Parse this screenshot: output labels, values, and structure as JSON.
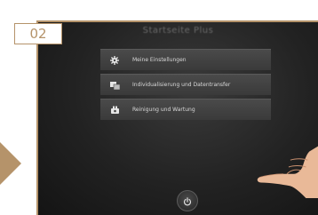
{
  "badge": {
    "number": "02"
  },
  "screen": {
    "title": "Startseite Plus",
    "menu": [
      {
        "label": "Meine Einstellungen",
        "icon": "gear-icon"
      },
      {
        "label": "Individualisierung und Datentransfer",
        "icon": "transfer-icon"
      },
      {
        "label": "Reinigung und Wartung",
        "icon": "cleaning-icon"
      }
    ],
    "power_icon": "power-icon"
  },
  "colors": {
    "accent": "#b5936a",
    "screen_bg": "#222222",
    "menu_item_bg": "#444444",
    "menu_text": "#d8d8d8"
  }
}
